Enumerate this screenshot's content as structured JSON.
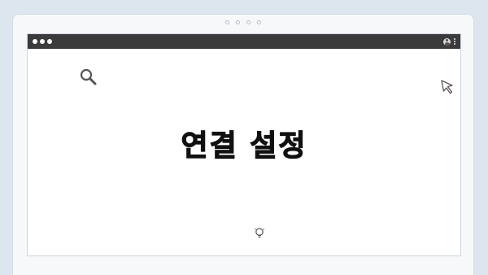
{
  "pager": {
    "count": 4
  },
  "window": {
    "controls": [
      "close",
      "minimize",
      "maximize"
    ]
  },
  "icons": {
    "search": "search-icon",
    "cursor": "cursor-icon",
    "lightbulb": "lightbulb-icon",
    "profile": "profile-icon",
    "menu": "kebab-menu-icon"
  },
  "main": {
    "title": "연결 설정"
  },
  "colors": {
    "background": "#dde6ef",
    "title_bar": "#3b3b3b",
    "text": "#111111"
  }
}
